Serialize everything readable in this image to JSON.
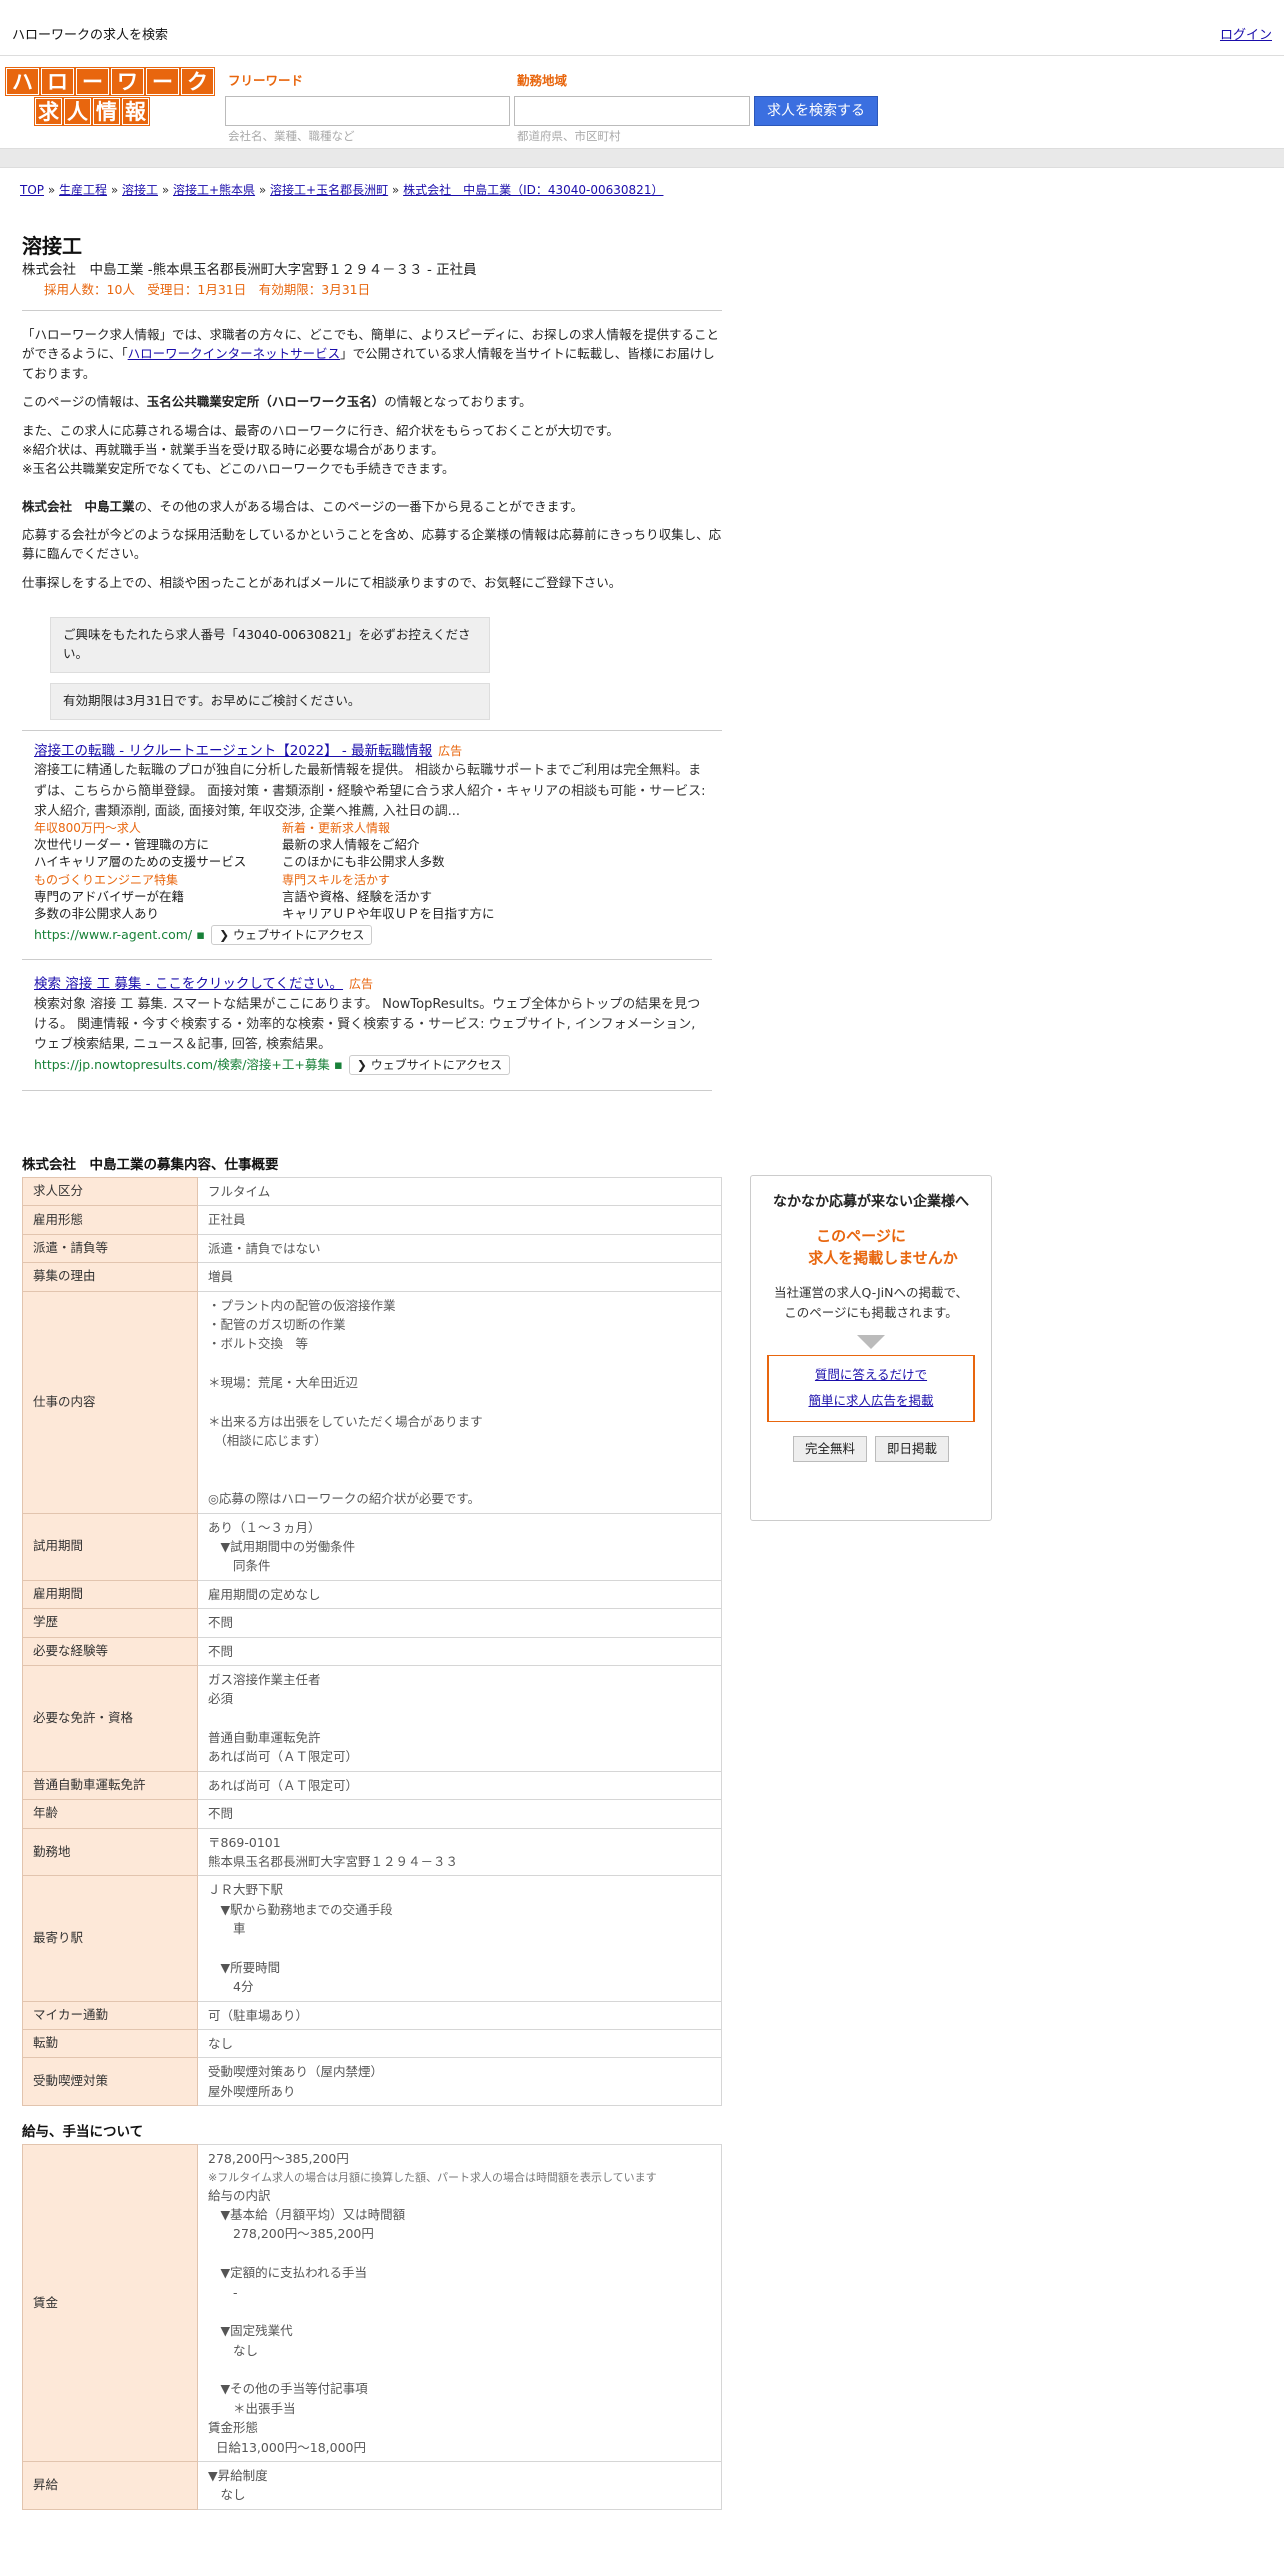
{
  "topbar": {
    "title": "ハローワークの求人を検索",
    "login": "ログイン"
  },
  "logo": {
    "row1": [
      "ハ",
      "ロ",
      "ー",
      "ワ",
      "ー",
      "ク"
    ],
    "row2": [
      "求",
      "人",
      "情",
      "報"
    ]
  },
  "search": {
    "freeword_label": "フリーワード",
    "area_label": "勤務地域",
    "freeword_placeholder": "会社名、業種、職種など",
    "area_placeholder": "都道府県、市区町村",
    "button": "求人を検索する"
  },
  "breadcrumb": [
    "TOP",
    "生産工程",
    "溶接工",
    "溶接工+熊本県",
    "溶接工+玉名郡長洲町",
    "株式会社　中島工業（ID：43040-00630821）"
  ],
  "job": {
    "title": "溶接工",
    "subtitle": "株式会社　中島工業 -熊本県玉名郡長洲町大字宮野１２９４－３３ - 正社員",
    "meta": "採用人数：10人　受理日：1月31日　有効期限：3月31日"
  },
  "intro": {
    "p1a": "「ハローワーク求人情報」では、求職者の方々に、どこでも、簡単に、よりスピーディに、お探しの求人情報を提供することができるように、「",
    "p1link": "ハローワークインターネットサービス",
    "p1b": "」で公開されている求人情報を当サイトに転載し、皆様にお届けしております。",
    "p2a": "このページの情報は、",
    "p2b": "玉名公共職業安定所（ハローワーク玉名）",
    "p2c": "の情報となっております。",
    "p3": "また、この求人に応募される場合は、最寄のハローワークに行き、紹介状をもらっておくことが大切です。\n※紹介状は、再就職手当・就業手当を受け取る時に必要な場合があります。\n※玉名公共職業安定所でなくても、どこのハローワークでも手続きできます。",
    "p4a": "株式会社　中島工業",
    "p4b": "の、その他の求人がある場合は、このページの一番下から見ることができます。",
    "p5": "応募する会社が今どのような採用活動をしているかということを含め、応募する企業様の情報は応募前にきっちり収集し、応募に臨んでください。",
    "p6": "仕事探しをする上での、相談や困ったことがあればメールにて相談承りますので、お気軽にご登録下さい。"
  },
  "notes": [
    "ご興味をもたれたら求人番号「43040-00630821」を必ずお控えください。",
    "有効期限は3月31日です。お早めにご検討ください。"
  ],
  "ads": [
    {
      "title": "溶接工の転職 - リクルートエージェント【2022】 - 最新転職情報",
      "tag": "広告",
      "desc": "溶接工に精通した転職のプロが独自に分析した最新情報を提供。 相談から転職サポートまでご利用は完全無料。まずは、こちらから簡単登録。 面接対策・書類添削・経験や希望に合う求人紹介・キャリアの相談も可能・サービス: 求人紹介, 書類添削, 面談, 面接対策, 年収交渉, 企業へ推薦, 入社日の調...",
      "sitelinks": [
        {
          "h": "年収800万円～求人",
          "l1": "次世代リーダー・管理職の方に",
          "l2": "ハイキャリア層のための支援サービス"
        },
        {
          "h": "新着・更新求人情報",
          "l1": "最新の求人情報をご紹介",
          "l2": "このほかにも非公開求人多数"
        },
        {
          "h": "ものづくりエンジニア特集",
          "l1": "専門のアドバイザーが在籍",
          "l2": "多数の非公開求人あり"
        },
        {
          "h": "専門スキルを活かす",
          "l1": "言語や資格、経験を活かす",
          "l2": "キャリアＵＰや年収ＵＰを目指す方に"
        }
      ],
      "url": "https://www.r-agent.com/",
      "visit": "ウェブサイトにアクセス"
    },
    {
      "title": "検索 溶接 工 募集 - ここをクリックしてください。",
      "tag": "広告",
      "desc": "検索対象 溶接 工 募集. スマートな結果がここにあります。 NowTopResults。ウェブ全体からトップの結果を見つける。 関連情報・今すぐ検索する・効率的な検索・賢く検索する・サービス: ウェブサイト, インフォメーション, ウェブ検索結果, ニュース＆記事, 回答, 検索結果。",
      "url": "https://jp.nowtopresults.com/検索/溶接+工+募集",
      "visit": "ウェブサイトにアクセス"
    }
  ],
  "overview": {
    "title": "株式会社　中島工業の募集内容、仕事概要",
    "rows": [
      {
        "k": "求人区分",
        "v": "フルタイム"
      },
      {
        "k": "雇用形態",
        "v": "正社員"
      },
      {
        "k": "派遣・請負等",
        "v": "派遣・請負ではない"
      },
      {
        "k": "募集の理由",
        "v": "増員"
      },
      {
        "k": "仕事の内容",
        "v": "・プラント内の配管の仮溶接作業\n・配管のガス切断の作業\n・ボルト交換　等\n\n＊現場：荒尾・大牟田近辺\n\n＊出来る方は出張をしていただく場合があります\n　（相談に応じます）\n\n\n◎応募の際はハローワークの紹介状が必要です。"
      },
      {
        "k": "試用期間",
        "v": "あり（１～３ヵ月）\n　▼試用期間中の労働条件\n　　同条件"
      },
      {
        "k": "雇用期間",
        "v": "雇用期間の定めなし"
      },
      {
        "k": "学歴",
        "v": "不問"
      },
      {
        "k": "必要な経験等",
        "v": "不問"
      },
      {
        "k": "必要な免許・資格",
        "v": "ガス溶接作業主任者\n必須\n\n普通自動車運転免許\nあれば尚可（ＡＴ限定可）\n"
      },
      {
        "k": "普通自動車運転免許",
        "v": "あれば尚可（ＡＴ限定可）"
      },
      {
        "k": "年齢",
        "v": "不問"
      },
      {
        "k": "勤務地",
        "v": "〒869-0101\n熊本県玉名郡長洲町大字宮野１２９４－３３"
      },
      {
        "k": "最寄り駅",
        "v": "ＪＲ大野下駅\n　▼駅から勤務地までの交通手段\n　　車\n\n　▼所要時間\n　　4分"
      },
      {
        "k": "マイカー通勤",
        "v": "可（駐車場あり）"
      },
      {
        "k": "転勤",
        "v": "なし"
      },
      {
        "k": "受動喫煙対策",
        "v": "受動喫煙対策あり（屋内禁煙）\n屋外喫煙所あり"
      }
    ]
  },
  "salary": {
    "title": "給与、手当について",
    "k": "賃金",
    "range": "278,200円〜385,200円",
    "note": "※フルタイム求人の場合は月額に換算した額、パート求人の場合は時間額を表示しています",
    "sub1": "給与の内訳",
    "items": "　▼基本給（月額平均）又は時間額\n　　278,200円〜385,200円\n\n　▼定額的に支払われる手当\n　　-\n\n　▼固定残業代\n　　なし\n\n　▼その他の手当等付記事項\n　　＊出張手当",
    "sub2": "賃金形態",
    "form": "日給13,000円〜18,000円",
    "k2": "昇給",
    "raise": "▼昇給制度\n　なし"
  },
  "side": {
    "head": "なかなか応募が来ない企業様へ",
    "offer1": "このページに",
    "offer2": "求人を掲載しませんか",
    "desc": "当社運営の求人Q-JiNへの掲載で、\nこのページにも掲載されます。",
    "link1": "質問に答えるだけで",
    "link2": "簡単に求人広告を掲載",
    "btn1": "完全無料",
    "btn2": "即日掲載"
  }
}
